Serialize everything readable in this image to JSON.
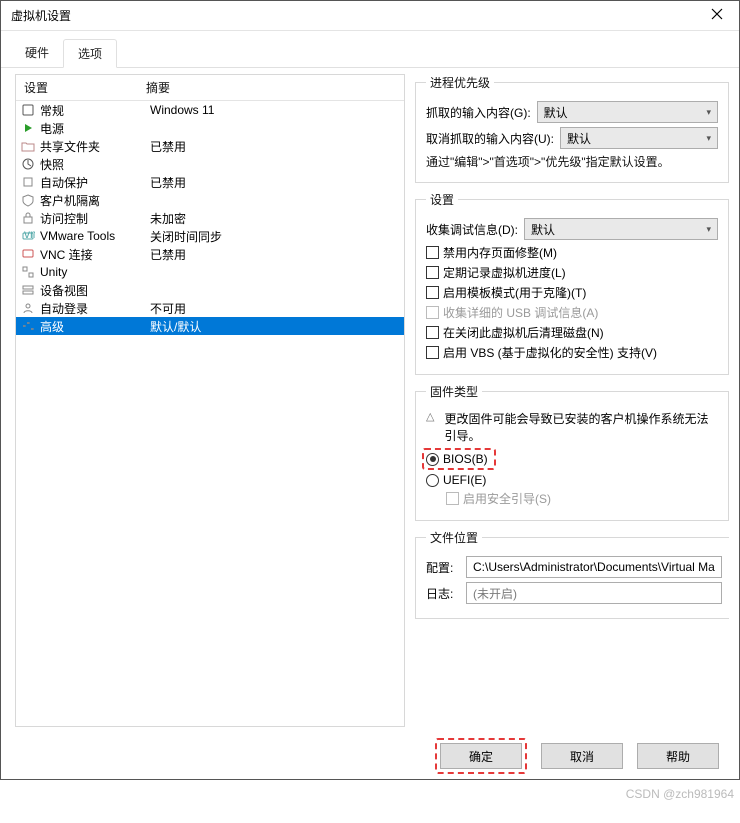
{
  "window": {
    "title": "虚拟机设置"
  },
  "tabs": {
    "hardware": "硬件",
    "options": "选项"
  },
  "list": {
    "header_device": "设置",
    "header_summary": "摘要",
    "items": [
      {
        "icon": "general-icon",
        "name": "常规",
        "summary": "Windows 11"
      },
      {
        "icon": "power-icon",
        "name": "电源",
        "summary": ""
      },
      {
        "icon": "folder-icon",
        "name": "共享文件夹",
        "summary": "已禁用"
      },
      {
        "icon": "snapshot-icon",
        "name": "快照",
        "summary": ""
      },
      {
        "icon": "autoprot-icon",
        "name": "自动保护",
        "summary": "已禁用"
      },
      {
        "icon": "isolation-icon",
        "name": "客户机隔离",
        "summary": ""
      },
      {
        "icon": "access-icon",
        "name": "访问控制",
        "summary": "未加密"
      },
      {
        "icon": "vmtools-icon",
        "name": "VMware Tools",
        "summary": "关闭时间同步"
      },
      {
        "icon": "vnc-icon",
        "name": "VNC 连接",
        "summary": "已禁用"
      },
      {
        "icon": "unity-icon",
        "name": "Unity",
        "summary": ""
      },
      {
        "icon": "devview-icon",
        "name": "设备视图",
        "summary": ""
      },
      {
        "icon": "autologin-icon",
        "name": "自动登录",
        "summary": "不可用"
      },
      {
        "icon": "advanced-icon",
        "name": "高级",
        "summary": "默认/默认"
      }
    ],
    "selected_index": 12
  },
  "process_priority": {
    "legend": "进程优先级",
    "grab_label": "抓取的输入内容(G):",
    "grab_value": "默认",
    "ungrab_label": "取消抓取的输入内容(U):",
    "ungrab_value": "默认",
    "hint": "通过\"编辑\">\"首选项\">\"优先级\"指定默认设置。"
  },
  "settings": {
    "legend": "设置",
    "debug_label": "收集调试信息(D):",
    "debug_value": "默认",
    "ck_mem": "禁用内存页面修整(M)",
    "ck_log": "定期记录虚拟机进度(L)",
    "ck_tpl": "启用模板模式(用于克隆)(T)",
    "ck_usb": "收集详细的 USB 调试信息(A)",
    "ck_clean": "在关闭此虚拟机后清理磁盘(N)",
    "ck_vbs": "启用 VBS (基于虚拟化的安全性) 支持(V)"
  },
  "firmware": {
    "legend": "固件类型",
    "warning": "更改固件可能会导致已安装的客户机操作系统无法引导。",
    "bios": "BIOS(B)",
    "uefi": "UEFI(E)",
    "secure": "启用安全引导(S)"
  },
  "file_location": {
    "legend": "文件位置",
    "config_label": "配置:",
    "config_value": "C:\\Users\\Administrator\\Documents\\Virtual Ma",
    "log_label": "日志:",
    "log_value": "(未开启)"
  },
  "buttons": {
    "ok": "确定",
    "cancel": "取消",
    "help": "帮助"
  },
  "watermark": "CSDN @zch981964"
}
